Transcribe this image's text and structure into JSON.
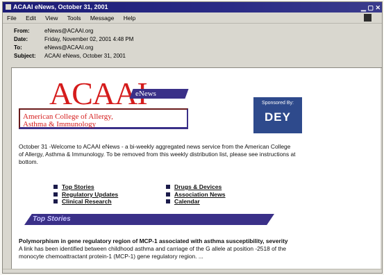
{
  "window": {
    "title": "ACAAI eNews, October 31, 2001"
  },
  "menubar": {
    "items": [
      "File",
      "Edit",
      "View",
      "Tools",
      "Message",
      "Help"
    ]
  },
  "headers": [
    {
      "key": "From:",
      "value": "eNews@ACAAI.org"
    },
    {
      "key": "Date:",
      "value": "Friday, November 02, 2001 4:48 PM"
    },
    {
      "key": "To:",
      "value": "eNews@ACAAI.org"
    },
    {
      "key": "Subject:",
      "value": "ACAAI eNews, October 31, 2001"
    }
  ],
  "logo": {
    "text": "ACAAI",
    "tag": "eNews",
    "college_line1": "American College of Allergy,",
    "college_line2": "Asthma & Immunology"
  },
  "sponsor": {
    "label": "Sponsored By:",
    "logo": "DEY"
  },
  "intro": "October 31 -Welcome to ACAAI eNews - a bi-weekly aggregated news service from the American College of Allergy, Asthma & Immunology. To be removed from this weekly distribution list, please see instructions at bottom.",
  "links": {
    "col1": [
      "Top Stories",
      "Regulatory Updates",
      "Clinical Research"
    ],
    "col2": [
      "Drugs & Devices",
      "Association News",
      "Calendar"
    ]
  },
  "section": {
    "title": "Top Stories"
  },
  "article": {
    "title": "Polymorphism in gene regulatory region of MCP-1 associated with asthma susceptibility, severity",
    "body": "A link has been identified between childhood asthma and carriage of the G allele at position -2518 of the monocyte chemoattractant protein-1 (MCP-1) gene regulatory region. ..."
  },
  "colors": {
    "accent_red": "#d51c1c",
    "accent_purple": "#3a3088",
    "title_bar": "#1c1d76"
  },
  "icons": [
    "window-icon",
    "minimize-icon",
    "maximize-icon",
    "close-icon",
    "bullet-icon"
  ]
}
